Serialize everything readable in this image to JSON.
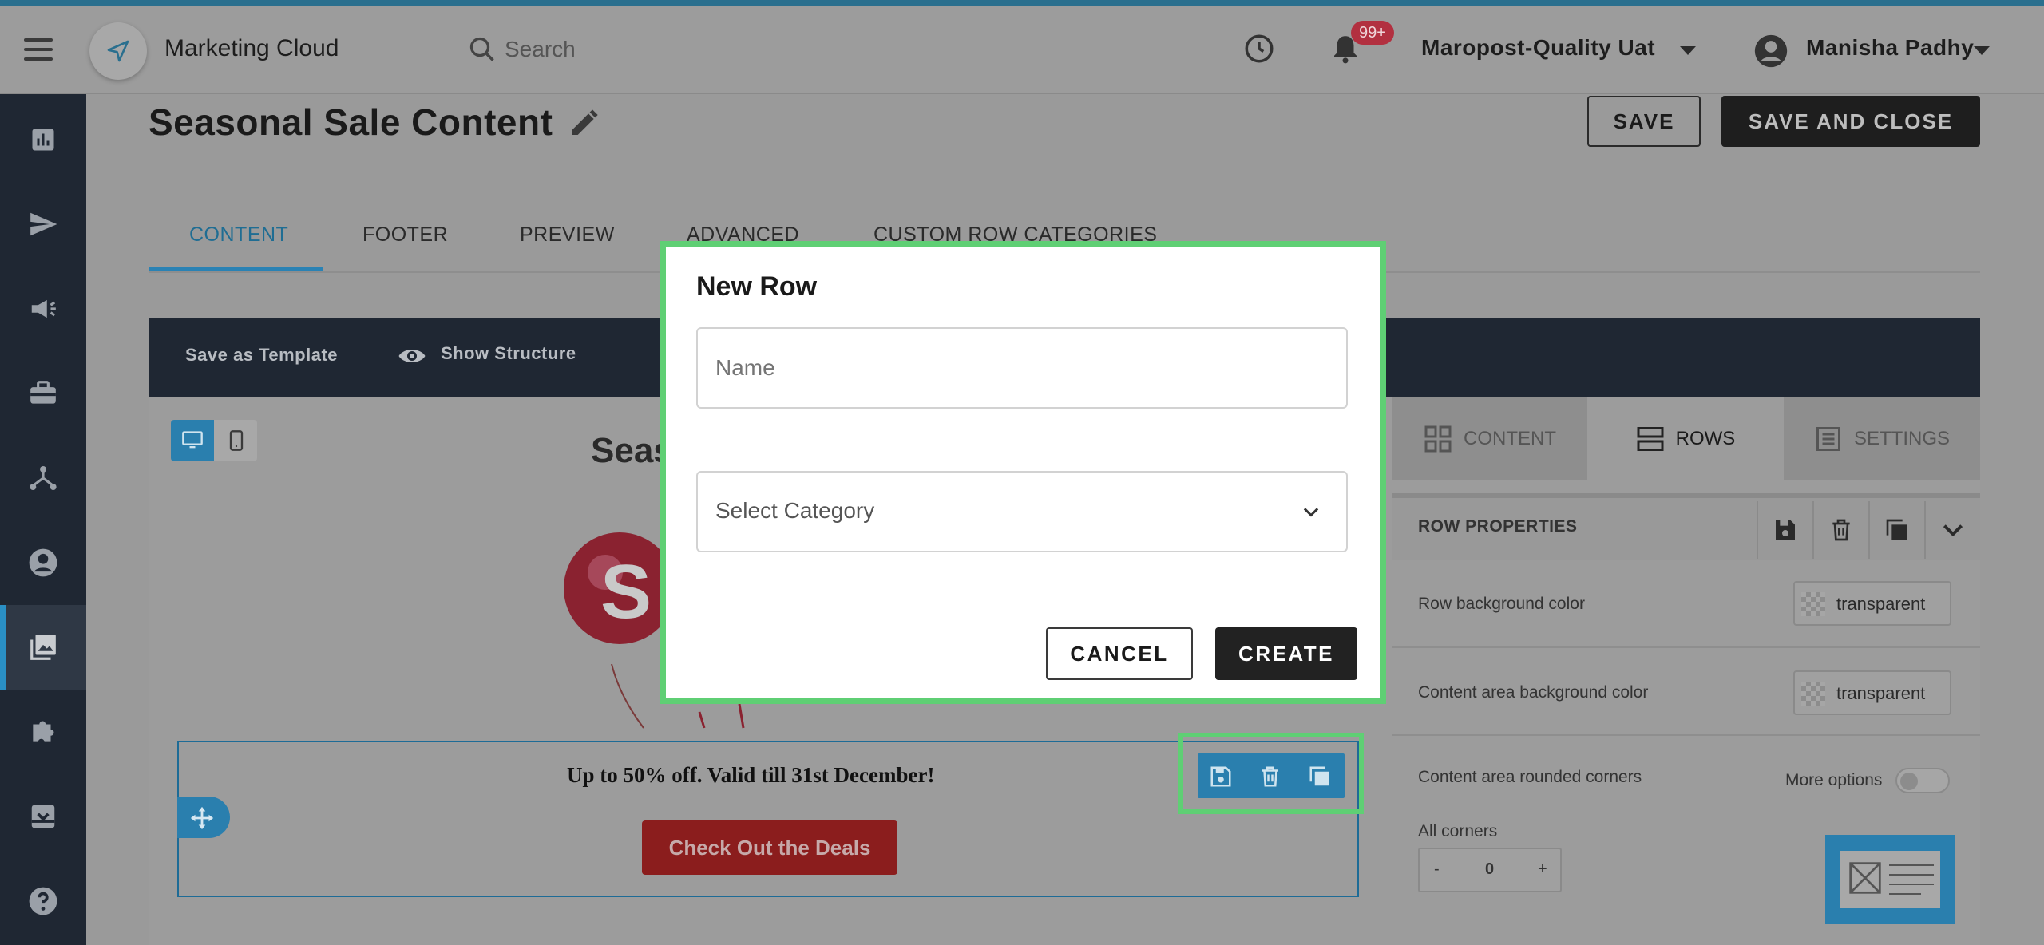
{
  "header": {
    "brand": "Marketing Cloud",
    "search_placeholder": "Search",
    "notification_count": "99+",
    "org_name": "Maropost-Quality Uat",
    "user_name": "Manisha Padhy"
  },
  "sidebar": {
    "items": [
      {
        "icon": "reports-icon"
      },
      {
        "icon": "send-icon"
      },
      {
        "icon": "megaphone-icon"
      },
      {
        "icon": "briefcase-icon"
      },
      {
        "icon": "journey-icon"
      },
      {
        "icon": "contact-icon"
      },
      {
        "icon": "content-images-icon",
        "active": true
      },
      {
        "icon": "puzzle-icon"
      },
      {
        "icon": "archive-icon"
      },
      {
        "icon": "help-icon"
      }
    ]
  },
  "page": {
    "title": "Seasonal Sale Content",
    "save_label": "SAVE",
    "save_close_label": "SAVE AND CLOSE"
  },
  "tabs": [
    {
      "label": "CONTENT",
      "active": true
    },
    {
      "label": "FOOTER"
    },
    {
      "label": "PREVIEW"
    },
    {
      "label": "ADVANCED"
    },
    {
      "label": "CUSTOM ROW CATEGORIES"
    }
  ],
  "toolbar": {
    "save_template": "Save as Template",
    "show_structure": "Show Structure"
  },
  "canvas": {
    "preview_title": "Seas",
    "row_text": "Up to 50% off. Valid till 31st December!",
    "cta_label": "Check Out the Deals"
  },
  "right_panel": {
    "tabs": [
      {
        "label": "CONTENT"
      },
      {
        "label": "ROWS",
        "active": true
      },
      {
        "label": "SETTINGS"
      }
    ],
    "section_title": "ROW PROPERTIES",
    "row_bg_label": "Row background color",
    "row_bg_value": "transparent",
    "content_bg_label": "Content area background color",
    "content_bg_value": "transparent",
    "rounded_label": "Content area rounded corners",
    "more_options": "More options",
    "all_corners": "All corners",
    "corner_value": "0",
    "minus": "-",
    "plus": "+"
  },
  "modal": {
    "title": "New Row",
    "name_placeholder": "Name",
    "category_placeholder": "Select Category",
    "cancel_label": "CANCEL",
    "create_label": "CREATE"
  },
  "colors": {
    "accent": "#2a82b4",
    "sidebar_bg": "#1f2733",
    "highlight": "#5fcf74",
    "cta_red": "#8b1d1d"
  }
}
